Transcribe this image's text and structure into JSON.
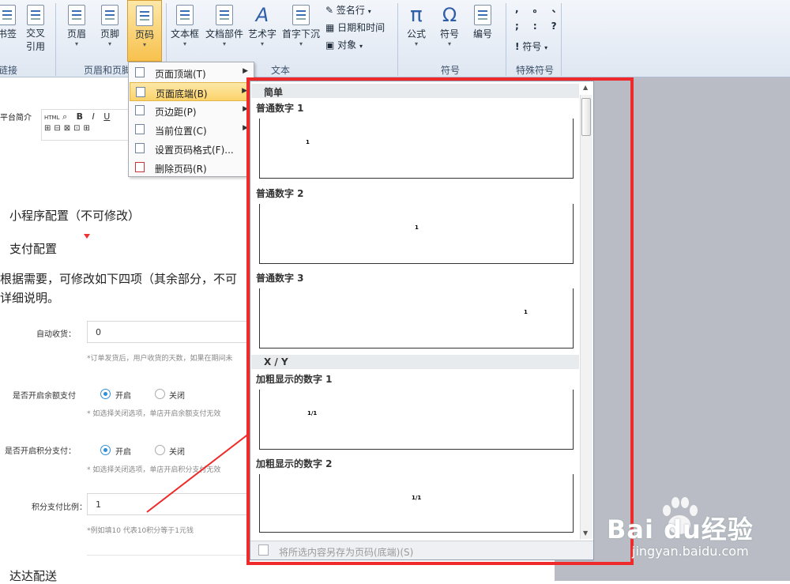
{
  "ribbon": {
    "buttons": {
      "bookmark": "书签",
      "crossref": "交叉\n引用",
      "header": "页眉",
      "footer": "页脚",
      "pagenum": "页码",
      "textbox": "文本框",
      "docparts": "文档部件",
      "wordart": "艺术字",
      "dropcap": "首字下沉",
      "signature": "签名行",
      "datetime": "日期和时间",
      "object": "对象",
      "equation": "公式",
      "symbol": "符号",
      "number": "编号",
      "special_symbol": "符号"
    },
    "groups": {
      "links": "链接",
      "header_footer": "页眉和页脚",
      "text": "文本",
      "symbols": "符号",
      "special": "特殊符号"
    },
    "punct": [
      ",",
      "。",
      "、",
      ";",
      ":",
      "?",
      "!"
    ]
  },
  "menu": {
    "items": [
      {
        "label": "页面顶端(T)"
      },
      {
        "label": "页面底端(B)"
      },
      {
        "label": "页边距(P)"
      },
      {
        "label": "当前位置(C)"
      },
      {
        "label": "设置页码格式(F)..."
      },
      {
        "label": "删除页码(R)"
      }
    ]
  },
  "gallery": {
    "cat_simple": "简单",
    "cat_xy": "X / Y",
    "items": [
      {
        "label": "普通数字 1",
        "num": "1"
      },
      {
        "label": "普通数字 2",
        "num": "1"
      },
      {
        "label": "普通数字 3",
        "num": "1"
      },
      {
        "label": "加粗显示的数字 1",
        "num": "1/1"
      },
      {
        "label": "加粗显示的数字 2",
        "num": "1/1"
      }
    ],
    "save_label": "将所选内容另存为页码(底端)(S)"
  },
  "doc": {
    "platform_intro": "平台简介",
    "mini_program": "小程序配置（不可修改）",
    "payment": "支付配置",
    "para1": "根据需要，可修改如下四项（其余部分，不可",
    "para2": "详细说明。",
    "auto_receive_label": "自动收货：",
    "auto_receive_value": "0",
    "auto_receive_hint": "*订单发货后，用户收货的天数，如果在期间未",
    "balance_label": "是否开启余额支付",
    "on": "开启",
    "off": "关闭",
    "balance_hint": "* 如选择关闭选项，单店开启余额支付无效",
    "points_label": "是否开启积分支付：",
    "points_hint": "* 如选择关闭选项，单店开启积分支付无效",
    "ratio_label": "积分支付比例：",
    "ratio_value": "1",
    "ratio_hint": "*例如填10 代表10积分等于1元钱",
    "dada": "达达配送",
    "toolbar_icons": "HTML"
  },
  "watermark": {
    "brand": "Bai du经验",
    "url": "jingyan.baidu.com"
  },
  "colors": {
    "highlight_red": "#ee2a2a",
    "radio_blue": "#2f8fd8",
    "menu_hover": "#fbd36a"
  }
}
